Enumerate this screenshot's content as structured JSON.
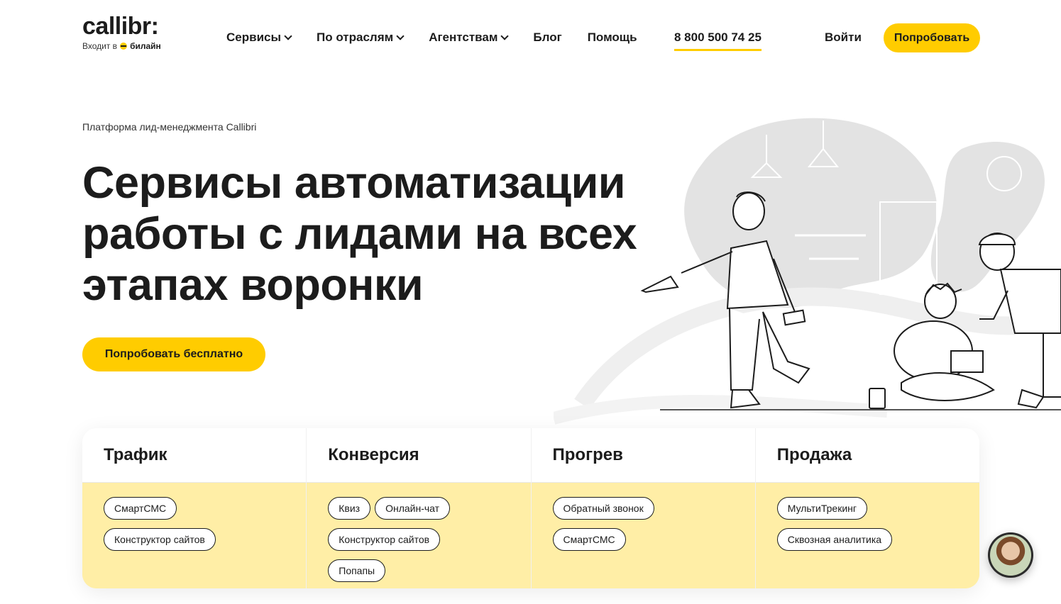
{
  "header": {
    "logo_text": "callibr:",
    "logo_sub_prefix": "Входит в",
    "logo_sub_brand": "билайн",
    "nav": [
      {
        "label": "Сервисы",
        "dropdown": true
      },
      {
        "label": "По отраслям",
        "dropdown": true
      },
      {
        "label": "Агентствам",
        "dropdown": true
      },
      {
        "label": "Блог",
        "dropdown": false
      },
      {
        "label": "Помощь",
        "dropdown": false
      }
    ],
    "phone": "8 800 500 74 25",
    "login": "Войти",
    "try": "Попробовать"
  },
  "hero": {
    "eyebrow": "Платформа лид-менеджмента Callibri",
    "title": "Сервисы автоматизации работы с лидами на всех этапах воронки",
    "cta": "Попробовать бесплатно"
  },
  "cards": [
    {
      "title": "Трафик",
      "tags": [
        "СмартСМС",
        "Конструктор сайтов"
      ]
    },
    {
      "title": "Конверсия",
      "tags": [
        "Квиз",
        "Онлайн-чат",
        "Конструктор сайтов",
        "Попапы"
      ]
    },
    {
      "title": "Прогрев",
      "tags": [
        "Обратный звонок",
        "СмартСМС"
      ]
    },
    {
      "title": "Продажа",
      "tags": [
        "МультиТрекинг",
        "Сквозная аналитика"
      ]
    }
  ],
  "colors": {
    "accent": "#ffcc00",
    "card_fill": "#ffeea6",
    "text": "#1c1c1c"
  },
  "icons": [
    "chevron-down-icon",
    "beeline-logo-icon",
    "chat-avatar-icon"
  ]
}
